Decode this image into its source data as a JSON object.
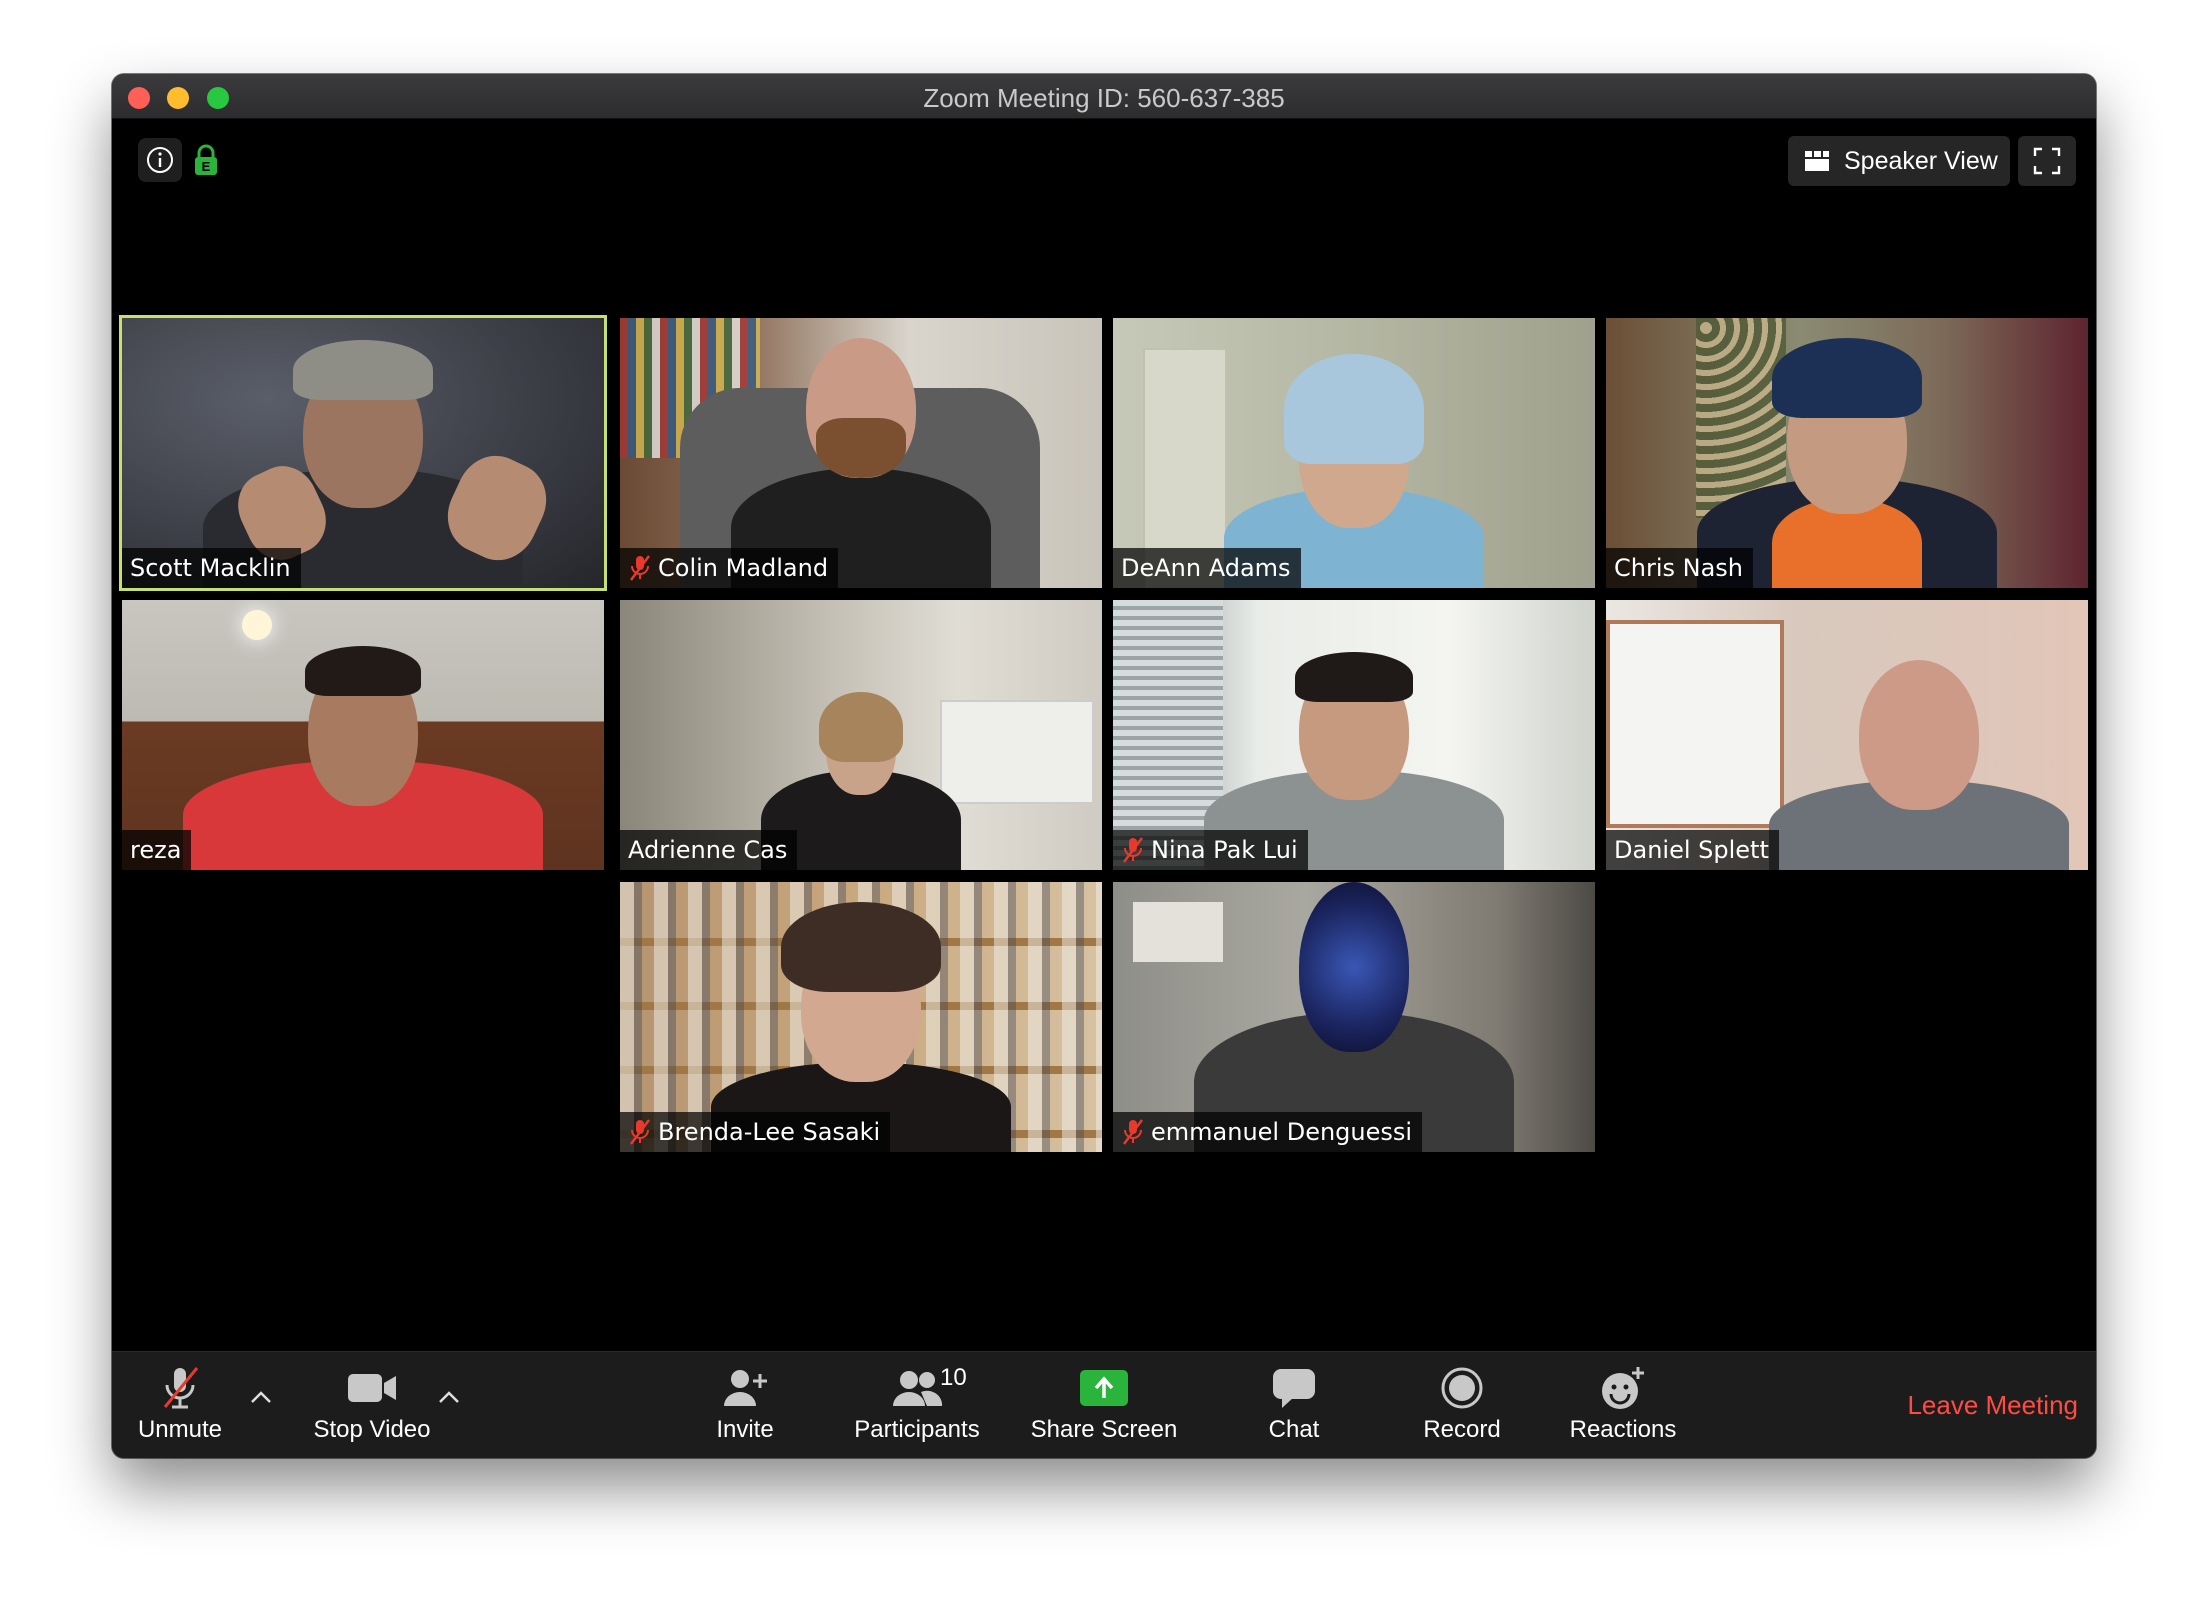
{
  "window": {
    "title": "Zoom Meeting ID: 560-637-385"
  },
  "top_bar": {
    "view_label": "Speaker View"
  },
  "participants": [
    {
      "name": "Scott Macklin",
      "muted": false,
      "active_speaker": true
    },
    {
      "name": "Colin Madland",
      "muted": true,
      "active_speaker": false
    },
    {
      "name": "DeAnn Adams",
      "muted": false,
      "active_speaker": false
    },
    {
      "name": "Chris Nash",
      "muted": false,
      "active_speaker": false
    },
    {
      "name": "reza",
      "muted": false,
      "active_speaker": false
    },
    {
      "name": "Adrienne Cas",
      "muted": false,
      "active_speaker": false
    },
    {
      "name": "Nina Pak Lui",
      "muted": true,
      "active_speaker": false
    },
    {
      "name": "Daniel Splett",
      "muted": false,
      "active_speaker": false
    },
    {
      "name": "Brenda-Lee Sasaki",
      "muted": true,
      "active_speaker": false
    },
    {
      "name": "emmanuel Denguessi",
      "muted": true,
      "active_speaker": false
    }
  ],
  "toolbar": {
    "unmute_label": "Unmute",
    "stop_video_label": "Stop Video",
    "invite_label": "Invite",
    "participants_label": "Participants",
    "participants_count": "10",
    "share_screen_label": "Share Screen",
    "chat_label": "Chat",
    "record_label": "Record",
    "reactions_label": "Reactions",
    "leave_label": "Leave Meeting"
  },
  "colors": {
    "active_speaker_border": "#c7e070",
    "share_screen_green": "#2ab43b",
    "leave_red": "#ff4b41",
    "muted_red": "#e8392c"
  }
}
